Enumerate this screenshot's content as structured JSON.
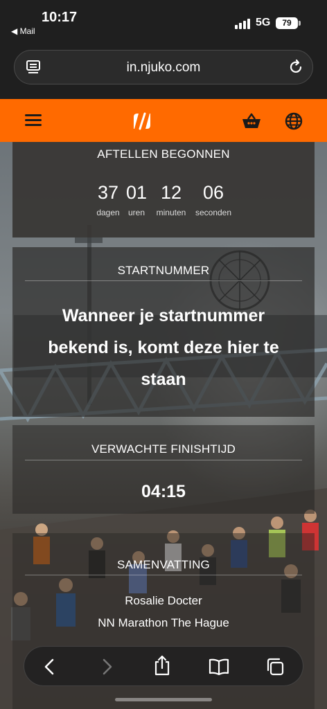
{
  "status_bar": {
    "time": "10:17",
    "back_app": "◀ Mail",
    "network": "5G",
    "battery": "79"
  },
  "browser": {
    "url": "in.njuko.com"
  },
  "header": {
    "brand_color": "#ff6a00",
    "logo": "njuko-logo-icon"
  },
  "countdown": {
    "title": "AFTELLEN BEGONNEN",
    "units": [
      {
        "value": "37",
        "label": "dagen"
      },
      {
        "value": "01",
        "label": "uren"
      },
      {
        "value": "12",
        "label": "minuten"
      },
      {
        "value": "06",
        "label": "seconden"
      }
    ]
  },
  "bib": {
    "title": "STARTNUMMER",
    "message": "Wanneer je startnummer bekend is, komt deze hier te staan"
  },
  "finish": {
    "title": "VERWACHTE FINISHTIJD",
    "time": "04:15"
  },
  "summary": {
    "title": "SAMENVATTING",
    "name": "Rosalie Docter",
    "event": "NN Marathon The Hague"
  },
  "toolbar": {
    "back": "chevron-left-icon",
    "forward": "chevron-right-icon",
    "share": "share-icon",
    "bookmarks": "book-icon",
    "tabs": "tabs-icon"
  }
}
